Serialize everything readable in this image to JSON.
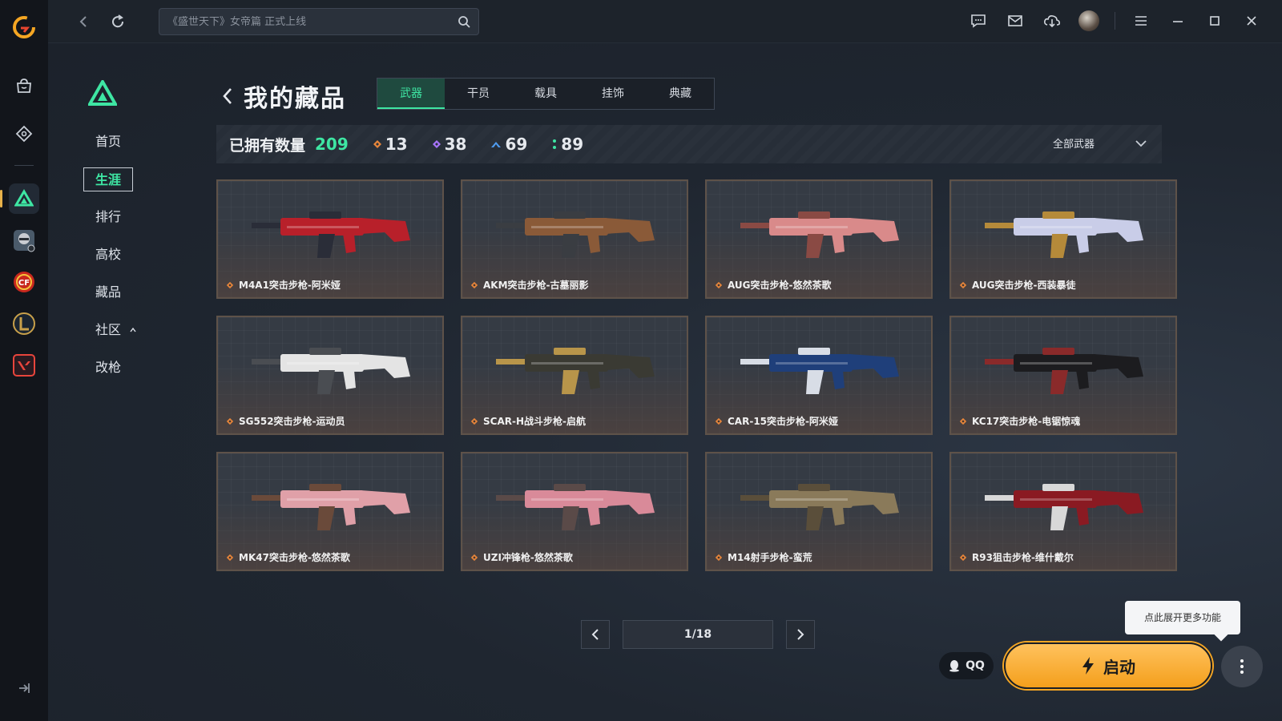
{
  "topbar": {
    "search_placeholder": "《盛世天下》女帝篇 正式上线"
  },
  "side_nav": {
    "items": [
      {
        "label": "首页",
        "active": false
      },
      {
        "label": "生涯",
        "active": true
      },
      {
        "label": "排行",
        "active": false
      },
      {
        "label": "高校",
        "active": false
      },
      {
        "label": "藏品",
        "active": false
      },
      {
        "label": "社区",
        "active": false
      },
      {
        "label": "改枪",
        "active": false
      }
    ]
  },
  "page": {
    "title": "我的藏品",
    "tabs": [
      "武器",
      "干员",
      "载具",
      "挂饰",
      "典藏"
    ],
    "active_tab": "武器"
  },
  "stats": {
    "owned_label": "已拥有数量",
    "owned_total": "209",
    "tiers": [
      {
        "value": "13",
        "color": "#e8863a"
      },
      {
        "value": "38",
        "color": "#a874ff"
      },
      {
        "value": "69",
        "color": "#4f9cf0"
      },
      {
        "value": "89",
        "color": "#3ee6a3"
      }
    ],
    "filter_label": "全部武器"
  },
  "items": [
    {
      "name": "M4A1突击步枪-阿米娅",
      "c1": "#b8202a",
      "c2": "#2a2d38"
    },
    {
      "name": "AKM突击步枪-古墓丽影",
      "c1": "#8a5a38",
      "c2": "#3a3d42"
    },
    {
      "name": "AUG突击步枪-悠然茶歌",
      "c1": "#d98a8a",
      "c2": "#8a4a44"
    },
    {
      "name": "AUG突击步枪-西装暴徒",
      "c1": "#c9cde8",
      "c2": "#b58a3a"
    },
    {
      "name": "SG552突击步枪-运动员",
      "c1": "#e4e4e4",
      "c2": "#4a4d52"
    },
    {
      "name": "SCAR-H战斗步枪-启航",
      "c1": "#3a3a33",
      "c2": "#b8954a"
    },
    {
      "name": "CAR-15突击步枪-阿米娅",
      "c1": "#1f3f7a",
      "c2": "#d8dde6"
    },
    {
      "name": "KC17突击步枪-电锯惊魂",
      "c1": "#1c1c1f",
      "c2": "#8a2a2a"
    },
    {
      "name": "MK47突击步枪-悠然茶歌",
      "c1": "#e0a0a8",
      "c2": "#6a4a3a"
    },
    {
      "name": "UZI冲锋枪-悠然茶歌",
      "c1": "#d98a99",
      "c2": "#5a4a48"
    },
    {
      "name": "M14射手步枪-蛮荒",
      "c1": "#8a7a5a",
      "c2": "#5a4e3a"
    },
    {
      "name": "R93狙击步枪-维什戴尔",
      "c1": "#8a1a22",
      "c2": "#d8d8d8"
    }
  ],
  "pager": {
    "page": "1/18"
  },
  "tooltip": "点此展开更多功能",
  "qq_label": "QQ",
  "launch_label": "启动"
}
